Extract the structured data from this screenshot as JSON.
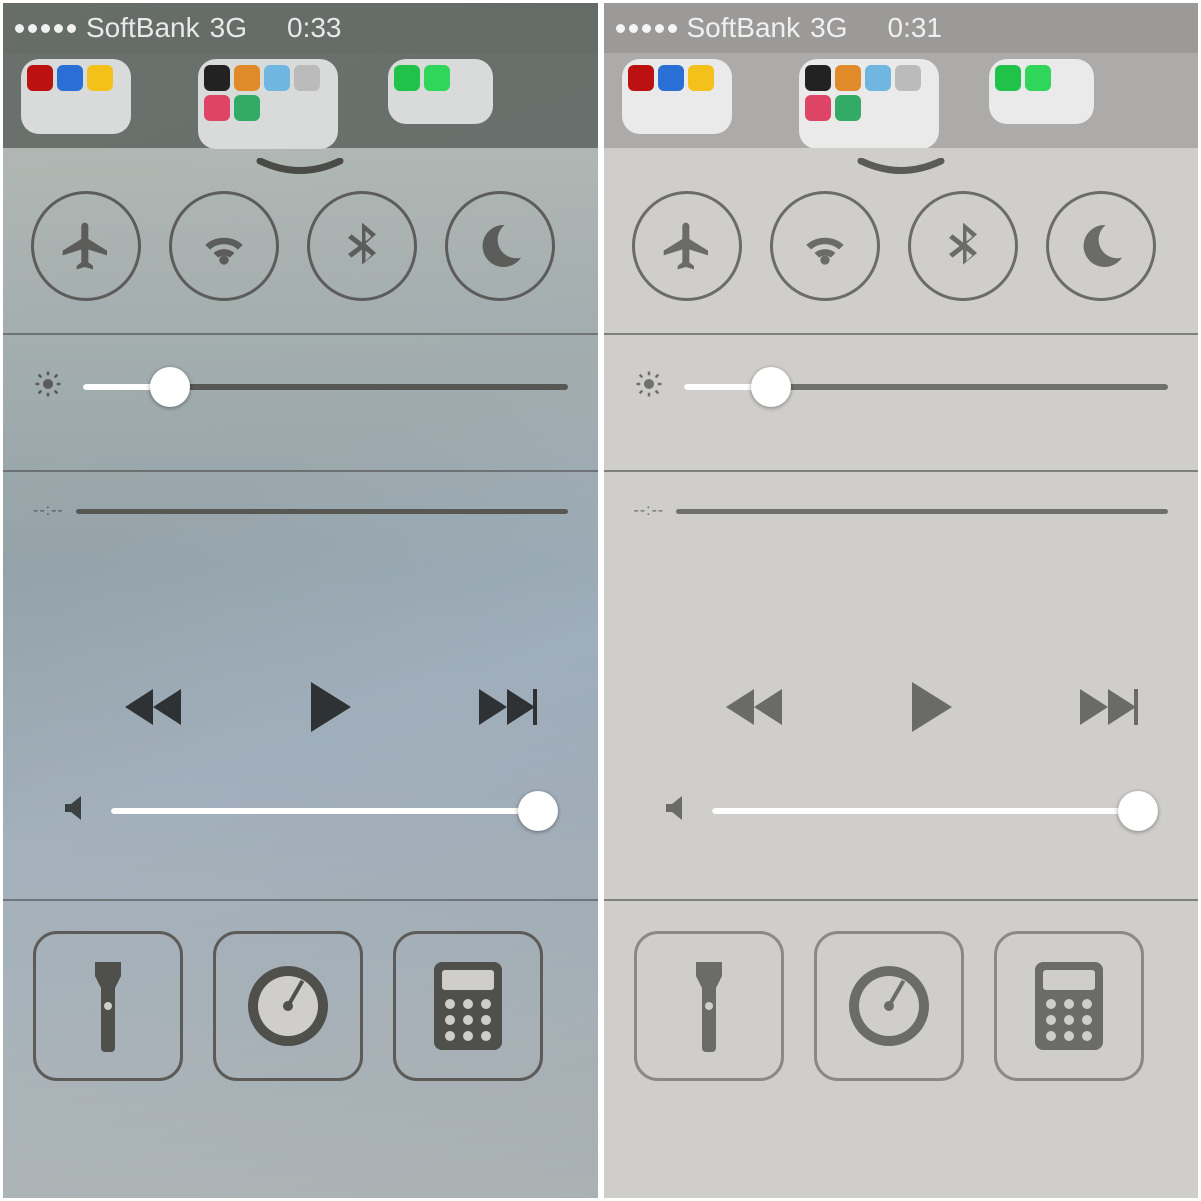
{
  "panels": [
    {
      "status": {
        "carrier": "SoftBank",
        "network": "3G",
        "time": "0:33"
      },
      "brightness_pct": 18,
      "volume_pct": 100,
      "scrub_elapsed": "--:--"
    },
    {
      "status": {
        "carrier": "SoftBank",
        "network": "3G",
        "time": "0:31"
      },
      "brightness_pct": 18,
      "volume_pct": 100,
      "scrub_elapsed": "--:--"
    }
  ],
  "toggles": [
    "airplane",
    "wifi",
    "bluetooth",
    "dnd"
  ],
  "shortcuts": [
    "flashlight",
    "timer",
    "calculator"
  ],
  "folder1_colors": [
    "#b11",
    "#2a6fd6",
    "#f3c11a"
  ],
  "folder2_colors": [
    "#222",
    "#e08a2a",
    "#6fb6e0",
    "#bbb",
    "#d46",
    "#3a6"
  ],
  "folder3_colors": [
    "#20c24a",
    "#2fd65a"
  ]
}
